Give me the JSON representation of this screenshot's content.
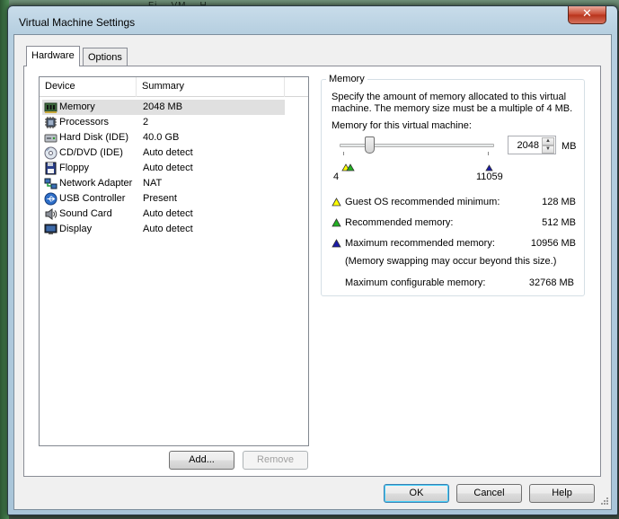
{
  "background": {
    "partial_title": "Fi... VM... H..."
  },
  "window": {
    "title": "Virtual Machine Settings",
    "close_label": "✕"
  },
  "tabs": [
    {
      "label": "Hardware",
      "active": true
    },
    {
      "label": "Options",
      "active": false
    }
  ],
  "device_list": {
    "columns": [
      "Device",
      "Summary"
    ],
    "rows": [
      {
        "name": "Memory",
        "summary": "2048 MB",
        "icon": "memory-icon",
        "selected": true
      },
      {
        "name": "Processors",
        "summary": "2",
        "icon": "processor-icon",
        "selected": false
      },
      {
        "name": "Hard Disk (IDE)",
        "summary": "40.0 GB",
        "icon": "hard-disk-icon",
        "selected": false
      },
      {
        "name": "CD/DVD (IDE)",
        "summary": "Auto detect",
        "icon": "cd-dvd-icon",
        "selected": false
      },
      {
        "name": "Floppy",
        "summary": "Auto detect",
        "icon": "floppy-icon",
        "selected": false
      },
      {
        "name": "Network Adapter",
        "summary": "NAT",
        "icon": "network-adapter-icon",
        "selected": false
      },
      {
        "name": "USB Controller",
        "summary": "Present",
        "icon": "usb-icon",
        "selected": false
      },
      {
        "name": "Sound Card",
        "summary": "Auto detect",
        "icon": "sound-card-icon",
        "selected": false
      },
      {
        "name": "Display",
        "summary": "Auto detect",
        "icon": "display-icon",
        "selected": false
      }
    ],
    "add_label": "Add...",
    "remove_label": "Remove"
  },
  "memory": {
    "group_title": "Memory",
    "description": "Specify the amount of memory allocated to this virtual machine. The memory size must be a multiple of 4 MB.",
    "field_label": "Memory for this virtual machine:",
    "value": "2048",
    "unit": "MB",
    "slider_min": "4",
    "slider_max": "11059",
    "legend": [
      {
        "label": "Guest OS recommended minimum:",
        "value": "128 MB",
        "color": "#ffff00"
      },
      {
        "label": "Recommended memory:",
        "value": "512 MB",
        "color": "#22b022"
      },
      {
        "label": "Maximum recommended memory:",
        "value": "10956 MB",
        "color": "#1a1aa8"
      }
    ],
    "note": "(Memory swapping may occur beyond this size.)",
    "max_configurable_label": "Maximum configurable memory:",
    "max_configurable_value": "32768 MB"
  },
  "footer": {
    "ok_label": "OK",
    "cancel_label": "Cancel",
    "help_label": "Help"
  }
}
